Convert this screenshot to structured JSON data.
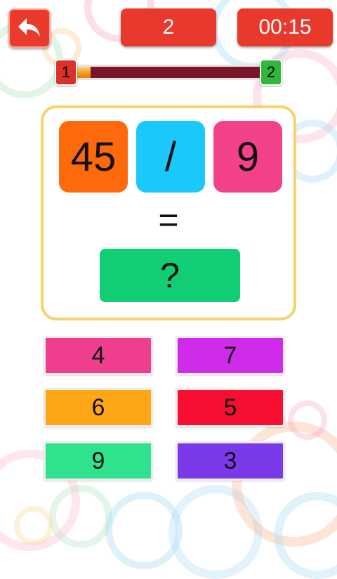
{
  "header": {
    "level": "2",
    "timer": "00:15"
  },
  "progress": {
    "start_level": "1",
    "end_level": "2",
    "fill_fraction": 0.1
  },
  "question": {
    "operand_a": "45",
    "operator": "/",
    "operand_b": "9",
    "equals": "=",
    "answer_placeholder": "?"
  },
  "choices": [
    {
      "label": "4",
      "color": "#ef3e8e"
    },
    {
      "label": "7",
      "color": "#cf2ce9"
    },
    {
      "label": "6",
      "color": "#fea613"
    },
    {
      "label": "5",
      "color": "#f70f32"
    },
    {
      "label": "9",
      "color": "#2fe38e"
    },
    {
      "label": "3",
      "color": "#7b3aea"
    }
  ],
  "icons": {
    "back": "back-arrow-icon"
  }
}
